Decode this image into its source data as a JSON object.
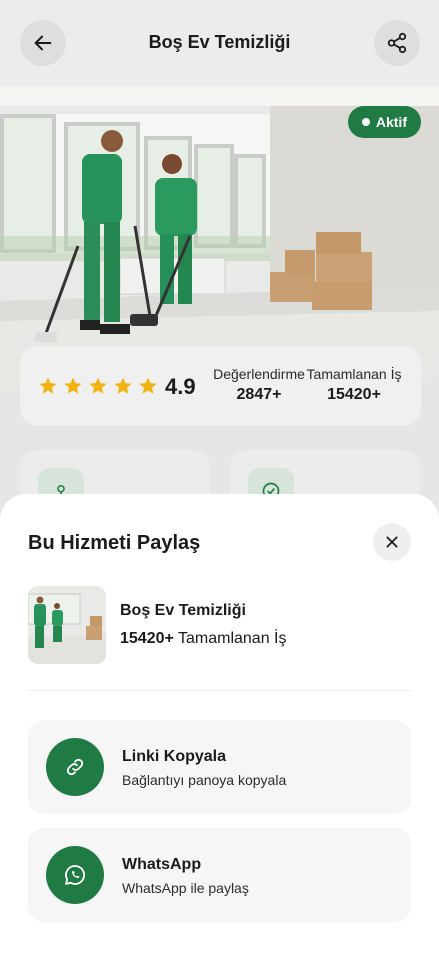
{
  "header": {
    "title": "Boş Ev Temizliği"
  },
  "hero": {
    "badge": "Aktif"
  },
  "rating": {
    "score": "4.9",
    "stars": 5,
    "reviews_label": "Değerlendirme",
    "reviews_value": "2847+",
    "jobs_label": "Tamamlanan İş",
    "jobs_value": "15420+"
  },
  "share_sheet": {
    "title": "Bu Hizmeti Paylaş",
    "preview": {
      "title": "Boş Ev Temizliği",
      "count": "15420+",
      "count_suffix": "Tamamlanan İş"
    },
    "options": [
      {
        "title": "Linki Kopyala",
        "subtitle": "Bağlantıyı panoya kopyala",
        "icon": "link-icon"
      },
      {
        "title": "WhatsApp",
        "subtitle": "WhatsApp ile paylaş",
        "icon": "whatsapp-icon"
      }
    ]
  },
  "colors": {
    "accent": "#1f7a43",
    "star": "#f2b312"
  }
}
